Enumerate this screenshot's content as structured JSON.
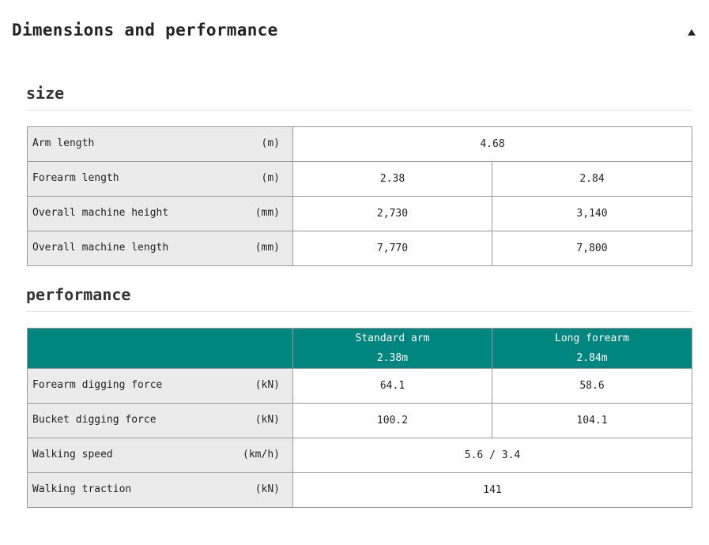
{
  "header": {
    "title": "Dimensions and performance"
  },
  "size": {
    "title": "size",
    "rows": [
      {
        "label": "Arm length",
        "unit": "(m)",
        "values": [
          "4.68"
        ]
      },
      {
        "label": "Forearm length",
        "unit": "(m)",
        "values": [
          "2.38",
          "2.84"
        ]
      },
      {
        "label": "Overall machine height",
        "unit": "(mm)",
        "values": [
          "2,730",
          "3,140"
        ]
      },
      {
        "label": "Overall machine length",
        "unit": "(mm)",
        "values": [
          "7,770",
          "7,800"
        ]
      }
    ]
  },
  "performance": {
    "title": "performance",
    "columns": [
      {
        "name": "Standard arm",
        "sub": "2.38m"
      },
      {
        "name": "Long forearm",
        "sub": "2.84m"
      }
    ],
    "rows": [
      {
        "label": "Forearm digging force",
        "unit": "(kN)",
        "values": [
          "64.1",
          "58.6"
        ]
      },
      {
        "label": "Bucket digging force",
        "unit": "(kN)",
        "values": [
          "100.2",
          "104.1"
        ]
      },
      {
        "label": "Walking speed",
        "unit": "(km/h)",
        "values": [
          "5.6 / 3.4"
        ]
      },
      {
        "label": "Walking traction",
        "unit": "(kN)",
        "values": [
          "141"
        ]
      }
    ]
  },
  "colors": {
    "header_bg": "#00857f",
    "label_bg": "#ebebeb",
    "border": "#9a9a9a"
  },
  "icons": {
    "collapse": "caret-up-icon"
  }
}
